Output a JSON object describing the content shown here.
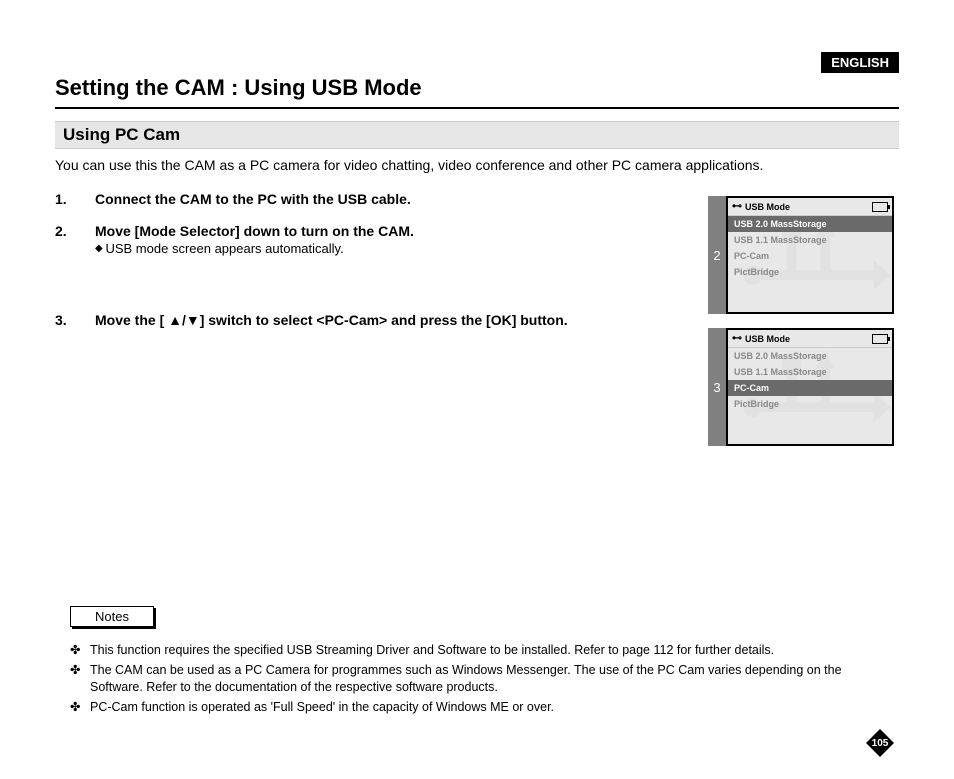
{
  "language_badge": "ENGLISH",
  "title": "Setting the CAM : Using USB Mode",
  "subtitle": "Using PC Cam",
  "intro": "You can use this the CAM as a PC camera for video chatting, video conference and other PC camera applications.",
  "steps": [
    {
      "num": "1.",
      "text": "Connect the CAM to the PC with the USB cable."
    },
    {
      "num": "2.",
      "text": "Move [Mode Selector] down to turn on the CAM.",
      "sub": "USB mode screen appears automatically."
    },
    {
      "num": "3.",
      "text": "Move the [ ▲/▼] switch to select <PC-Cam> and press the [OK] button."
    }
  ],
  "screens": [
    {
      "num": "2",
      "header": "USB Mode",
      "items": [
        "USB 2.0 MassStorage",
        "USB 1.1 MassStorage",
        "PC-Cam",
        "PictBridge"
      ],
      "selected": 0
    },
    {
      "num": "3",
      "header": "USB Mode",
      "items": [
        "USB 2.0 MassStorage",
        "USB 1.1 MassStorage",
        "PC-Cam",
        "PictBridge"
      ],
      "selected": 2
    }
  ],
  "notes_label": "Notes",
  "notes": [
    "This function requires the specified USB Streaming Driver and Software to be installed. Refer to page 112 for further details.",
    "The CAM can be used as a PC Camera for programmes such as Windows Messenger. The use of the PC Cam varies depending on the Software. Refer to the documentation of the respective software products.",
    "PC-Cam function is operated as 'Full Speed' in the capacity of Windows ME or over."
  ],
  "page_number": "105"
}
